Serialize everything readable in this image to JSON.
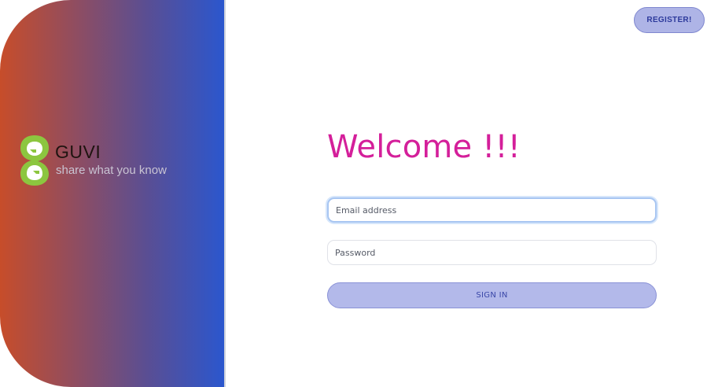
{
  "brand": {
    "name": "GUVI",
    "tagline": "share what you know",
    "logo_icon": "guvi-logo-icon",
    "colors": {
      "gradient_start": "#c74d2a",
      "gradient_end": "#2a57cf",
      "logo_green": "#8cc63f"
    }
  },
  "header": {
    "register_label": "REGISTER!"
  },
  "login": {
    "heading": "Welcome !!!",
    "email_placeholder": "Email address",
    "password_placeholder": "Password",
    "signin_label": "SIGN IN"
  },
  "colors": {
    "heading": "#d41f9a",
    "button_bg": "#b3b9ea",
    "button_text": "#3a47a8"
  }
}
